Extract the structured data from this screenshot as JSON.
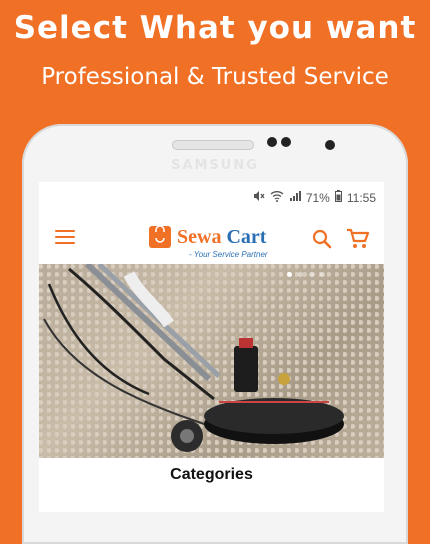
{
  "promo": {
    "headline": "Select What you want",
    "subheadline": "Professional & Trusted Service"
  },
  "device": {
    "brand": "SAMSUNG"
  },
  "status_bar": {
    "battery": "71%",
    "time": "11:55"
  },
  "app_bar": {
    "logo_name_part1": "Sewa",
    "logo_name_part2": "Cart",
    "logo_tagline": "- Your Service Partner",
    "menu_icon": "hamburger-icon",
    "search_icon": "search-icon",
    "cart_icon": "cart-icon"
  },
  "carousel": {
    "slide_count": 4,
    "active_slide": 1,
    "image": "carpet cleaning machine"
  },
  "sections": {
    "categories_title": "Categories"
  },
  "colors": {
    "accent": "#f07026",
    "brand_blue": "#2b6fb3"
  }
}
